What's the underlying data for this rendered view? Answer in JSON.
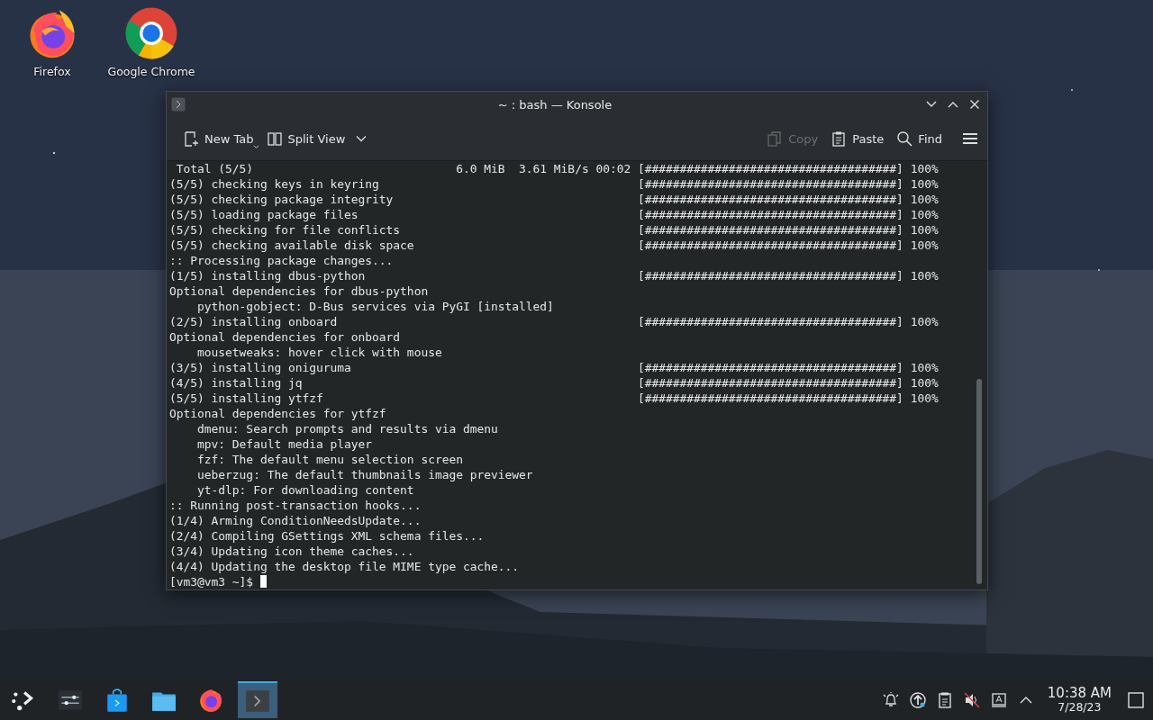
{
  "desktop_icons": [
    {
      "kind": "firefox",
      "label": "Firefox"
    },
    {
      "kind": "chrome",
      "label": "Google Chrome"
    }
  ],
  "window": {
    "title": "~ : bash — Konsole",
    "toolbar": [
      {
        "kind": "new-tab",
        "label": "New Tab",
        "disabled": false
      },
      {
        "kind": "split-view",
        "label": "Split View",
        "disabled": false
      },
      {
        "kind": "copy",
        "label": "Copy",
        "disabled": true
      },
      {
        "kind": "paste",
        "label": "Paste",
        "disabled": false
      },
      {
        "kind": "find",
        "label": "Find",
        "disabled": false
      }
    ],
    "lines": [
      {
        "text": " Total (5/5)                             6.0 MiB  3.61 MiB/s 00:02",
        "progress": "[####################################]",
        "percent": "100%"
      },
      {
        "text": "(5/5) checking keys in keyring",
        "progress": "[####################################]",
        "percent": "100%"
      },
      {
        "text": "(5/5) checking package integrity",
        "progress": "[####################################]",
        "percent": "100%"
      },
      {
        "text": "(5/5) loading package files",
        "progress": "[####################################]",
        "percent": "100%"
      },
      {
        "text": "(5/5) checking for file conflicts",
        "progress": "[####################################]",
        "percent": "100%"
      },
      {
        "text": "(5/5) checking available disk space",
        "progress": "[####################################]",
        "percent": "100%"
      },
      {
        "text": ":: Processing package changes..."
      },
      {
        "text": "(1/5) installing dbus-python",
        "progress": "[####################################]",
        "percent": "100%"
      },
      {
        "text": "Optional dependencies for dbus-python"
      },
      {
        "text": "    python-gobject: D-Bus services via PyGI [installed]"
      },
      {
        "text": "(2/5) installing onboard",
        "progress": "[####################################]",
        "percent": "100%"
      },
      {
        "text": "Optional dependencies for onboard"
      },
      {
        "text": "    mousetweaks: hover click with mouse"
      },
      {
        "text": "(3/5) installing oniguruma",
        "progress": "[####################################]",
        "percent": "100%"
      },
      {
        "text": "(4/5) installing jq",
        "progress": "[####################################]",
        "percent": "100%"
      },
      {
        "text": "(5/5) installing ytfzf",
        "progress": "[####################################]",
        "percent": "100%"
      },
      {
        "text": "Optional dependencies for ytfzf"
      },
      {
        "text": "    dmenu: Search prompts and results via dmenu"
      },
      {
        "text": "    mpv: Default media player"
      },
      {
        "text": "    fzf: The default menu selection screen"
      },
      {
        "text": "    ueberzug: The default thumbnails image previewer"
      },
      {
        "text": "    yt-dlp: For downloading content"
      },
      {
        "text": ":: Running post-transaction hooks..."
      },
      {
        "text": "(1/4) Arming ConditionNeedsUpdate..."
      },
      {
        "text": "(2/4) Compiling GSettings XML schema files..."
      },
      {
        "text": "(3/4) Updating icon theme caches..."
      },
      {
        "text": "(4/4) Updating the desktop file MIME type cache..."
      }
    ],
    "prompt": "[vm3@vm3 ~]$"
  },
  "taskbar": {
    "tasks": [
      {
        "kind": "launcher",
        "selected": false
      },
      {
        "kind": "settings",
        "selected": false
      },
      {
        "kind": "store",
        "selected": false
      },
      {
        "kind": "files",
        "selected": false
      },
      {
        "kind": "firefox",
        "selected": false
      },
      {
        "kind": "terminal",
        "selected": true
      }
    ],
    "tray": [
      {
        "kind": "bell"
      },
      {
        "kind": "update"
      },
      {
        "kind": "clipboard"
      },
      {
        "kind": "muted"
      },
      {
        "kind": "keyboard"
      },
      {
        "kind": "expand"
      }
    ],
    "time": "10:38 AM",
    "date": "7/28/23"
  }
}
